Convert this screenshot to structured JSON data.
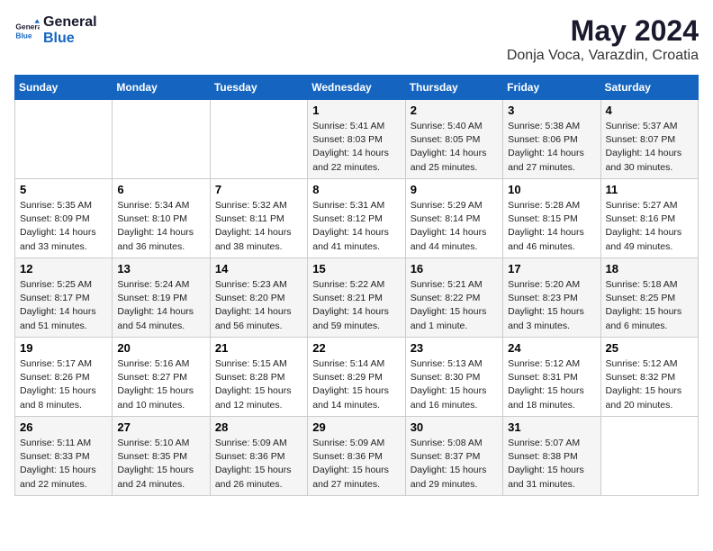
{
  "header": {
    "logo_general": "General",
    "logo_blue": "Blue",
    "month_year": "May 2024",
    "location": "Donja Voca, Varazdin, Croatia"
  },
  "weekdays": [
    "Sunday",
    "Monday",
    "Tuesday",
    "Wednesday",
    "Thursday",
    "Friday",
    "Saturday"
  ],
  "weeks": [
    [
      {
        "day": "",
        "info": ""
      },
      {
        "day": "",
        "info": ""
      },
      {
        "day": "",
        "info": ""
      },
      {
        "day": "1",
        "info": "Sunrise: 5:41 AM\nSunset: 8:03 PM\nDaylight: 14 hours\nand 22 minutes."
      },
      {
        "day": "2",
        "info": "Sunrise: 5:40 AM\nSunset: 8:05 PM\nDaylight: 14 hours\nand 25 minutes."
      },
      {
        "day": "3",
        "info": "Sunrise: 5:38 AM\nSunset: 8:06 PM\nDaylight: 14 hours\nand 27 minutes."
      },
      {
        "day": "4",
        "info": "Sunrise: 5:37 AM\nSunset: 8:07 PM\nDaylight: 14 hours\nand 30 minutes."
      }
    ],
    [
      {
        "day": "5",
        "info": "Sunrise: 5:35 AM\nSunset: 8:09 PM\nDaylight: 14 hours\nand 33 minutes."
      },
      {
        "day": "6",
        "info": "Sunrise: 5:34 AM\nSunset: 8:10 PM\nDaylight: 14 hours\nand 36 minutes."
      },
      {
        "day": "7",
        "info": "Sunrise: 5:32 AM\nSunset: 8:11 PM\nDaylight: 14 hours\nand 38 minutes."
      },
      {
        "day": "8",
        "info": "Sunrise: 5:31 AM\nSunset: 8:12 PM\nDaylight: 14 hours\nand 41 minutes."
      },
      {
        "day": "9",
        "info": "Sunrise: 5:29 AM\nSunset: 8:14 PM\nDaylight: 14 hours\nand 44 minutes."
      },
      {
        "day": "10",
        "info": "Sunrise: 5:28 AM\nSunset: 8:15 PM\nDaylight: 14 hours\nand 46 minutes."
      },
      {
        "day": "11",
        "info": "Sunrise: 5:27 AM\nSunset: 8:16 PM\nDaylight: 14 hours\nand 49 minutes."
      }
    ],
    [
      {
        "day": "12",
        "info": "Sunrise: 5:25 AM\nSunset: 8:17 PM\nDaylight: 14 hours\nand 51 minutes."
      },
      {
        "day": "13",
        "info": "Sunrise: 5:24 AM\nSunset: 8:19 PM\nDaylight: 14 hours\nand 54 minutes."
      },
      {
        "day": "14",
        "info": "Sunrise: 5:23 AM\nSunset: 8:20 PM\nDaylight: 14 hours\nand 56 minutes."
      },
      {
        "day": "15",
        "info": "Sunrise: 5:22 AM\nSunset: 8:21 PM\nDaylight: 14 hours\nand 59 minutes."
      },
      {
        "day": "16",
        "info": "Sunrise: 5:21 AM\nSunset: 8:22 PM\nDaylight: 15 hours\nand 1 minute."
      },
      {
        "day": "17",
        "info": "Sunrise: 5:20 AM\nSunset: 8:23 PM\nDaylight: 15 hours\nand 3 minutes."
      },
      {
        "day": "18",
        "info": "Sunrise: 5:18 AM\nSunset: 8:25 PM\nDaylight: 15 hours\nand 6 minutes."
      }
    ],
    [
      {
        "day": "19",
        "info": "Sunrise: 5:17 AM\nSunset: 8:26 PM\nDaylight: 15 hours\nand 8 minutes."
      },
      {
        "day": "20",
        "info": "Sunrise: 5:16 AM\nSunset: 8:27 PM\nDaylight: 15 hours\nand 10 minutes."
      },
      {
        "day": "21",
        "info": "Sunrise: 5:15 AM\nSunset: 8:28 PM\nDaylight: 15 hours\nand 12 minutes."
      },
      {
        "day": "22",
        "info": "Sunrise: 5:14 AM\nSunset: 8:29 PM\nDaylight: 15 hours\nand 14 minutes."
      },
      {
        "day": "23",
        "info": "Sunrise: 5:13 AM\nSunset: 8:30 PM\nDaylight: 15 hours\nand 16 minutes."
      },
      {
        "day": "24",
        "info": "Sunrise: 5:12 AM\nSunset: 8:31 PM\nDaylight: 15 hours\nand 18 minutes."
      },
      {
        "day": "25",
        "info": "Sunrise: 5:12 AM\nSunset: 8:32 PM\nDaylight: 15 hours\nand 20 minutes."
      }
    ],
    [
      {
        "day": "26",
        "info": "Sunrise: 5:11 AM\nSunset: 8:33 PM\nDaylight: 15 hours\nand 22 minutes."
      },
      {
        "day": "27",
        "info": "Sunrise: 5:10 AM\nSunset: 8:35 PM\nDaylight: 15 hours\nand 24 minutes."
      },
      {
        "day": "28",
        "info": "Sunrise: 5:09 AM\nSunset: 8:36 PM\nDaylight: 15 hours\nand 26 minutes."
      },
      {
        "day": "29",
        "info": "Sunrise: 5:09 AM\nSunset: 8:36 PM\nDaylight: 15 hours\nand 27 minutes."
      },
      {
        "day": "30",
        "info": "Sunrise: 5:08 AM\nSunset: 8:37 PM\nDaylight: 15 hours\nand 29 minutes."
      },
      {
        "day": "31",
        "info": "Sunrise: 5:07 AM\nSunset: 8:38 PM\nDaylight: 15 hours\nand 31 minutes."
      },
      {
        "day": "",
        "info": ""
      }
    ]
  ]
}
